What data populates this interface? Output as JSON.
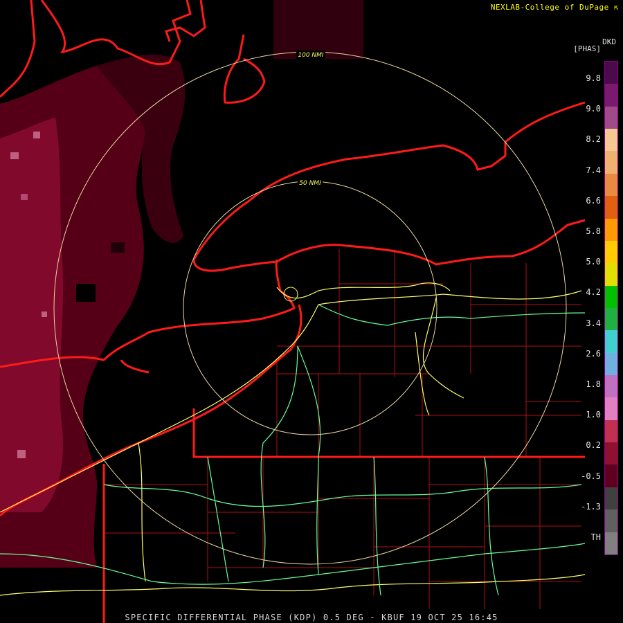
{
  "header": {
    "credit": "NEXLAB-College of DuPage ⇱"
  },
  "legend": {
    "product": "DKD",
    "unit": "[PHAS]",
    "tick_labels": [
      "9.8",
      "9.0",
      "8.2",
      "7.4",
      "6.6",
      "5.8",
      "5.0",
      "4.2",
      "3.4",
      "2.6",
      "1.8",
      "1.0",
      "0.2",
      "-0.5",
      "-1.3",
      "TH"
    ],
    "colors": [
      "#4b0a4b",
      "#7a1a6e",
      "#a04a8a",
      "#f4c890",
      "#f0b070",
      "#e88a40",
      "#e06010",
      "#ff9a00",
      "#ffcc00",
      "#e0e000",
      "#00c000",
      "#20b040",
      "#40d0d0",
      "#70b0e0",
      "#c070c0",
      "#e080c0",
      "#c03050",
      "#901030",
      "#600020",
      "#404040",
      "#606060",
      "#808080"
    ]
  },
  "rings": {
    "inner_label": "50 NMI",
    "outer_label": "100 NMI"
  },
  "footer": {
    "caption": "SPECIFIC DIFFERENTIAL PHASE (KDP) 0.5 DEG - KBUF 19 OCT 25 16:45"
  },
  "colors": {
    "boundary": "#ff1a1a",
    "county": "#c01010",
    "ring": "#e8d8a0",
    "highway_yellow": "#ffff66",
    "highway_green": "#66ff99",
    "echo": "#7a0a24"
  }
}
